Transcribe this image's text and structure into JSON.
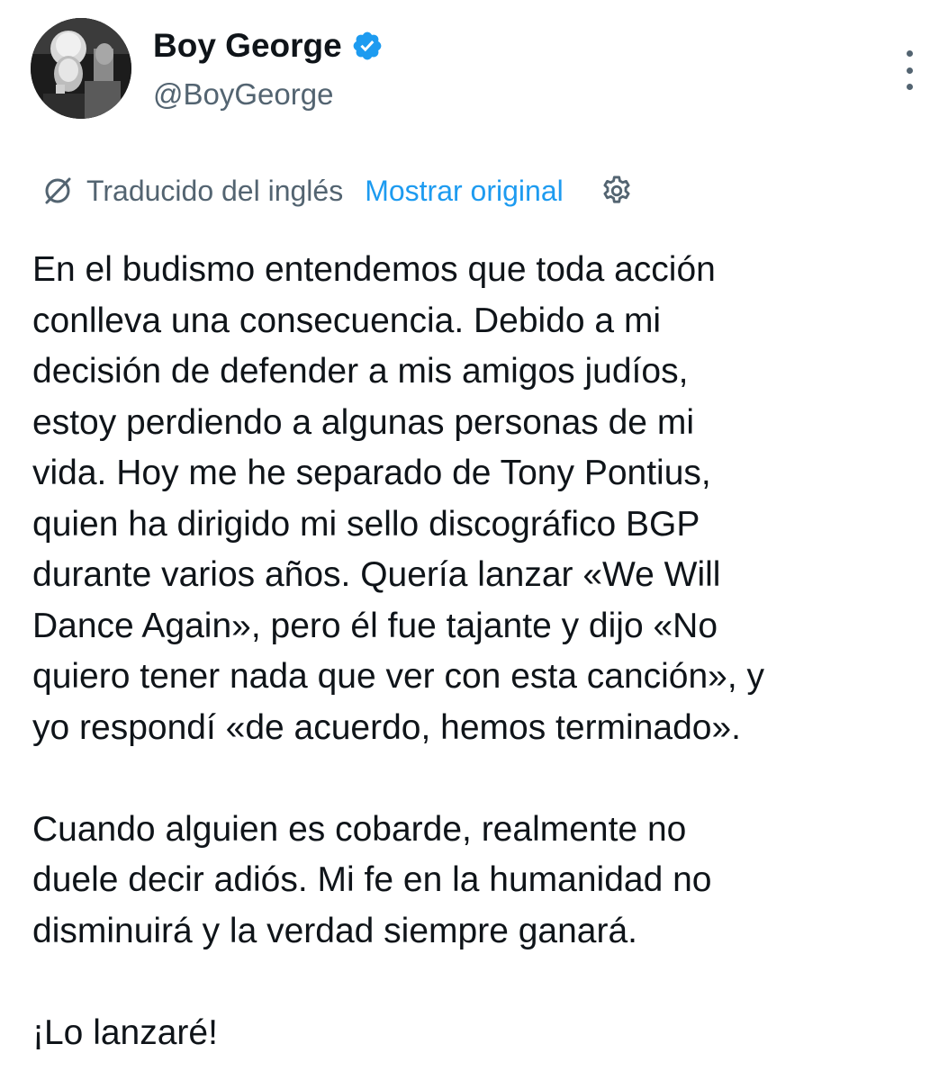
{
  "author": {
    "display_name": "Boy George",
    "handle": "@BoyGeorge",
    "verified": true,
    "avatar_icon": "black-and-white-profile-photo"
  },
  "translation": {
    "label": "Traducido del inglés",
    "show_original": "Mostrar original",
    "icon": "translate-icon",
    "settings_icon": "gear-icon"
  },
  "tweet": {
    "paragraphs": [
      [
        "En el budismo entendemos que toda acción",
        "conlleva una consecuencia. Debido a mi",
        "decisión de defender a mis amigos judíos,",
        "estoy perdiendo a algunas personas de mi",
        "vida. Hoy me he separado de Tony Pontius,",
        "quien ha dirigido mi sello discográfico BGP",
        "durante varios años. Quería lanzar «We Will",
        "Dance Again», pero él fue tajante y dijo «No",
        "quiero tener nada que ver con esta canción», y",
        "yo respondí «de acuerdo, hemos terminado»."
      ],
      [
        "Cuando alguien es cobarde, realmente no",
        "duele decir adiós. Mi fe en la humanidad no",
        "disminuirá y la verdad siempre ganará."
      ],
      [
        "¡Lo lanzaré!"
      ]
    ]
  },
  "colors": {
    "text": "#0f1419",
    "secondary": "#536471",
    "link": "#1d9bf0",
    "verified_badge": "#1d9bf0"
  }
}
